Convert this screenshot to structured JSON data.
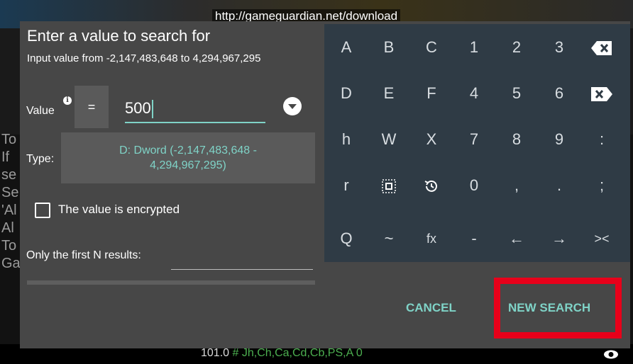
{
  "url_overlay": "http://gameguardian.net/download",
  "background": {
    "side_text": "To\nIf\nse\nSe\n'Al\nAl\nTo\nGa",
    "bottom_value": "101.0",
    "bottom_hash": "#",
    "bottom_flags": "Jh,Ch,Ca,Cd,Cb,PS,A 0",
    "eye_icon": "eye-icon"
  },
  "dialog": {
    "title": "Enter a value to search for",
    "range": "Input value from -2,147,483,648 to 4,294,967,295",
    "value_label": "Value",
    "info_glyph": "i",
    "operator": "=",
    "value": "500",
    "type_label": "Type:",
    "type_value": "D: Dword (-2,147,483,648 - 4,294,967,295)",
    "encrypted_label": "The value is encrypted",
    "encrypted_checked": false,
    "first_n_label": "Only the first N results:",
    "first_n_value": "",
    "cancel_label": "CANCEL",
    "new_search_label": "NEW SEARCH"
  },
  "keyboard": {
    "rows": [
      [
        "A",
        "B",
        "C",
        "1",
        "2",
        "3",
        "⌫"
      ],
      [
        "D",
        "E",
        "F",
        "4",
        "5",
        "6",
        "⌦"
      ],
      [
        "h",
        "W",
        "X",
        "7",
        "8",
        "9",
        ":"
      ],
      [
        "r",
        "⬚",
        "⟲",
        "0",
        ",",
        ".",
        ";"
      ],
      [
        "Q",
        "~",
        "fx",
        "-",
        "←",
        "→",
        "><"
      ]
    ]
  },
  "colors": {
    "accent": "#7fd3c7",
    "dialog_bg": "#474747",
    "keyboard_bg": "#2f3b45",
    "highlight": "#e8001a"
  }
}
